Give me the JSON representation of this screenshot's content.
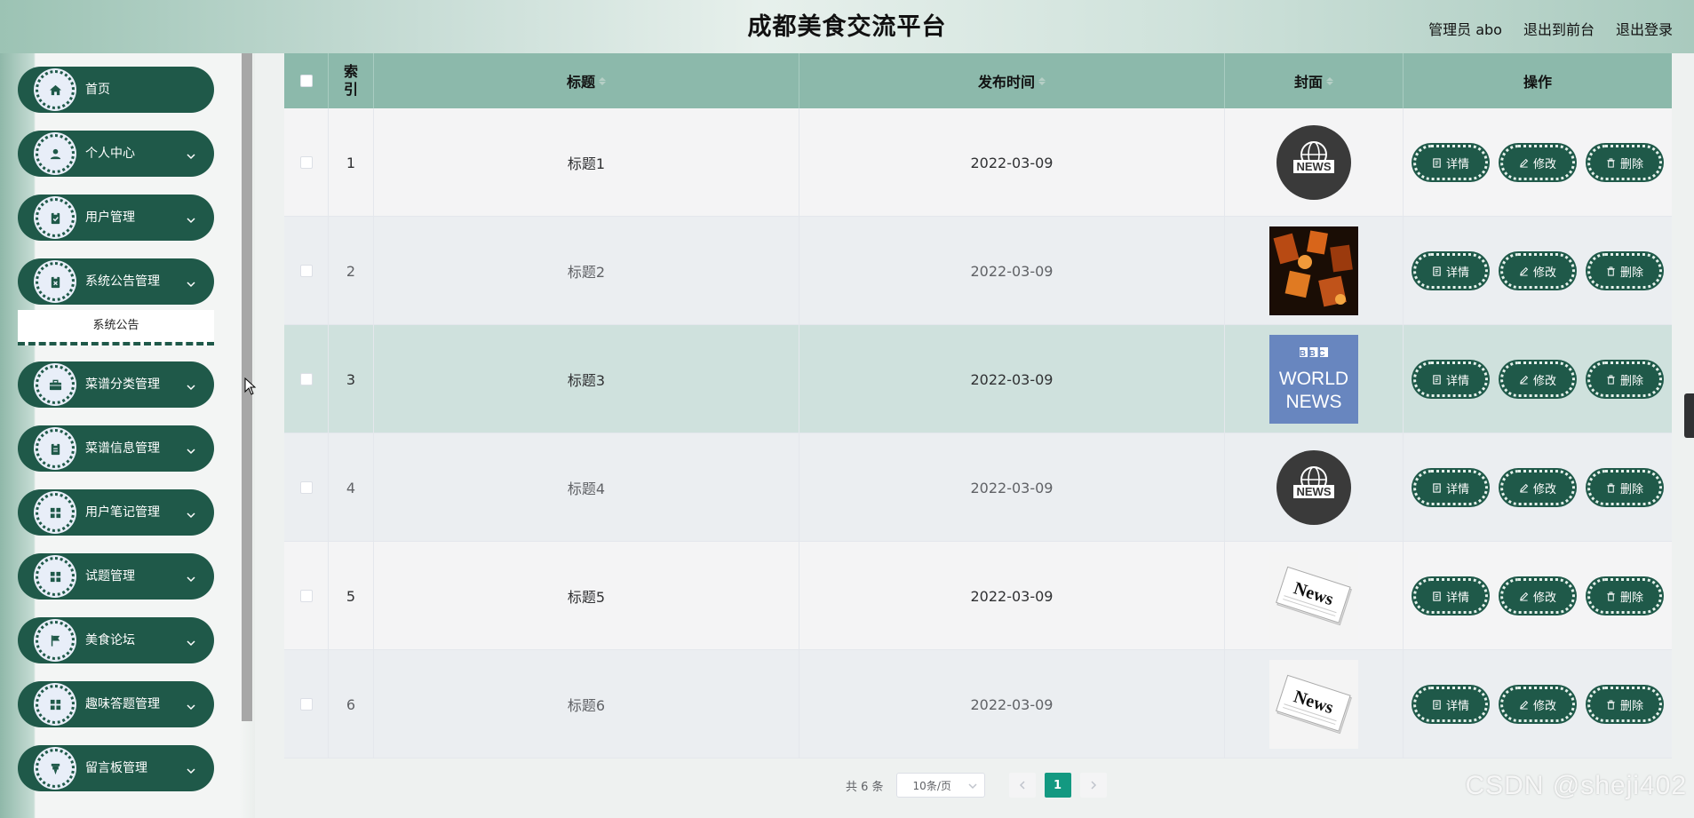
{
  "header": {
    "title": "成都美食交流平台",
    "user_label": "管理员 abo",
    "front_link": "退出到前台",
    "logout_link": "退出登录"
  },
  "sidebar": {
    "items": [
      {
        "label": "首页",
        "icon": "home-icon"
      },
      {
        "label": "个人中心",
        "icon": "user-icon"
      },
      {
        "label": "用户管理",
        "icon": "clipboard-check-icon"
      },
      {
        "label": "系统公告管理",
        "icon": "clipboard-x-icon"
      },
      {
        "label": "菜谱分类管理",
        "icon": "briefcase-icon"
      },
      {
        "label": "菜谱信息管理",
        "icon": "clipboard-list-icon"
      },
      {
        "label": "用户笔记管理",
        "icon": "grid-icon"
      },
      {
        "label": "试题管理",
        "icon": "grid-icon"
      },
      {
        "label": "美食论坛",
        "icon": "flag-icon"
      },
      {
        "label": "趣味答题管理",
        "icon": "grid-icon"
      },
      {
        "label": "留言板管理",
        "icon": "pin-icon"
      }
    ],
    "submenu_label": "系统公告"
  },
  "table": {
    "headers": {
      "index": "索\n引",
      "title": "标题",
      "publish_time": "发布时间",
      "cover": "封面",
      "actions": "操作"
    },
    "rows": [
      {
        "index": "1",
        "title": "标题1",
        "publish_time": "2022-03-09",
        "cover": "news-globe-icon"
      },
      {
        "index": "2",
        "title": "标题2",
        "publish_time": "2022-03-09",
        "cover": "currency-symbols-image"
      },
      {
        "index": "3",
        "title": "标题3",
        "publish_time": "2022-03-09",
        "cover": "bbc-world-news-logo"
      },
      {
        "index": "4",
        "title": "标题4",
        "publish_time": "2022-03-09",
        "cover": "news-globe-icon"
      },
      {
        "index": "5",
        "title": "标题5",
        "publish_time": "2022-03-09",
        "cover": "newspaper-icon"
      },
      {
        "index": "6",
        "title": "标题6",
        "publish_time": "2022-03-09",
        "cover": "newspaper-icon"
      }
    ],
    "action_labels": {
      "detail": "详情",
      "edit": "修改",
      "delete": "删除"
    }
  },
  "pagination": {
    "total": "共 6 条",
    "page_size": "10条/页",
    "current_page": "1"
  },
  "cover_text": {
    "news": "NEWS",
    "bbc": "BBC",
    "world": "WORLD",
    "news2": "NEWS",
    "paper": "News"
  },
  "watermark": "CSDN @sheji402",
  "colors": {
    "primary": "#1f5949",
    "table_header": "#8cb9ab",
    "highlight_row": "#cfe1dd",
    "page_active": "#139981"
  }
}
